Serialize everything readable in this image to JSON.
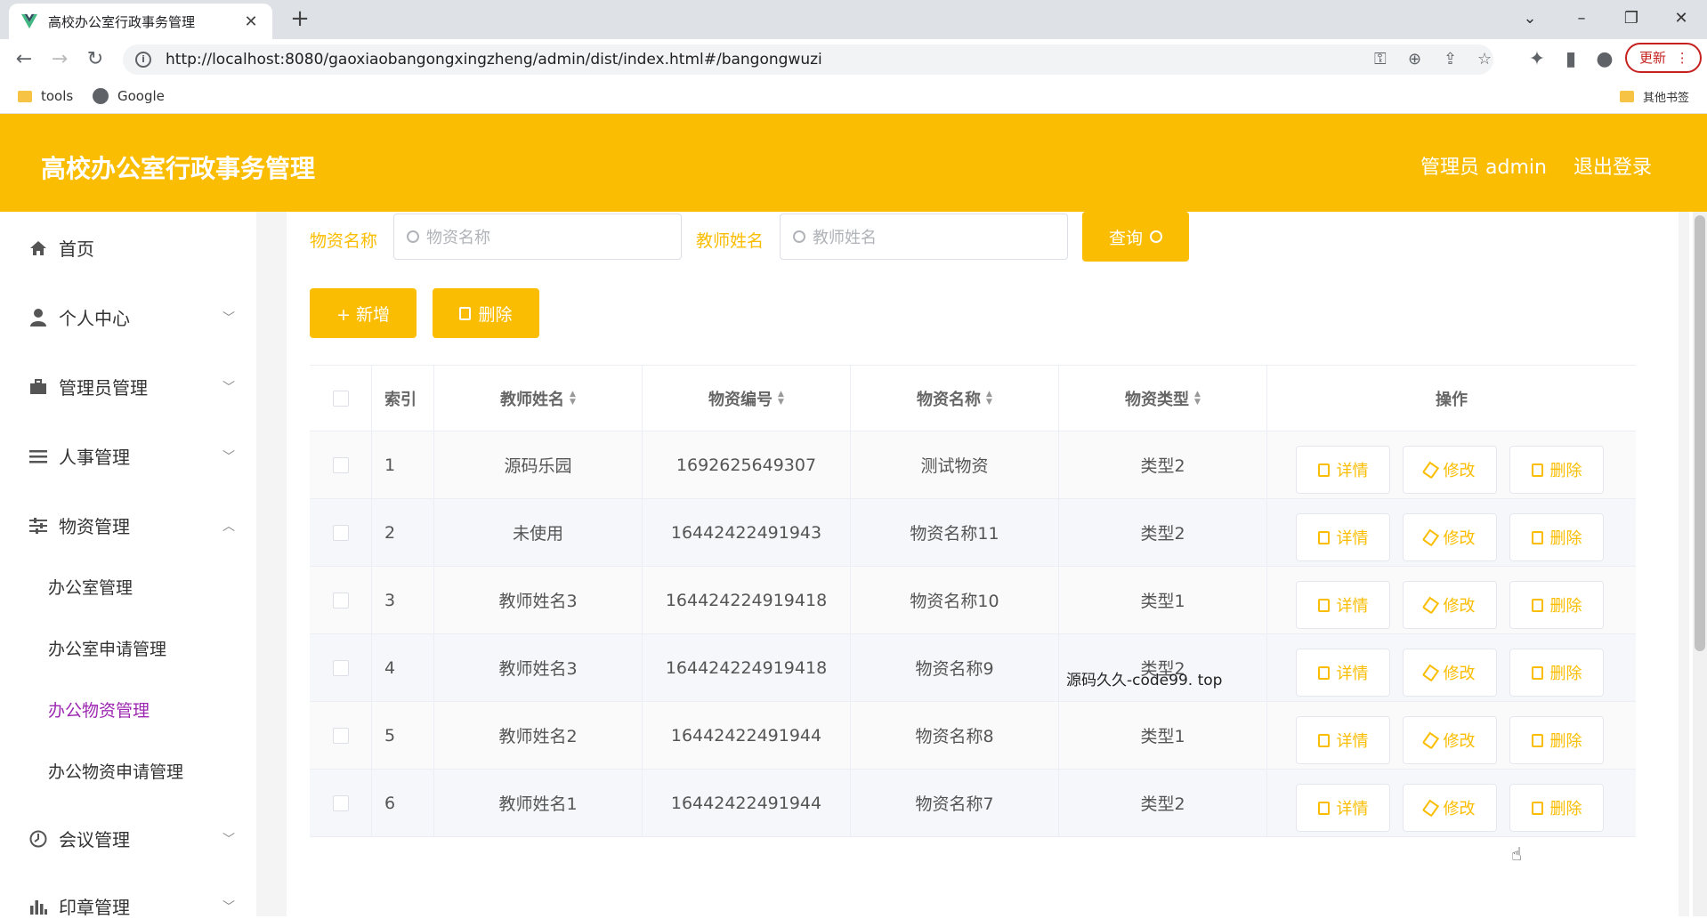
{
  "browser": {
    "tab_title": "高校办公室行政事务管理",
    "url": "http://localhost:8080/gaoxiaobangongxingzheng/admin/dist/index.html#/bangongwuzi",
    "update_label": "更新",
    "bookmarks": [
      "tools",
      "Google"
    ],
    "other_bookmarks": "其他书签"
  },
  "header": {
    "title": "高校办公室行政事务管理",
    "user": "管理员 admin",
    "logout": "退出登录"
  },
  "sidebar": {
    "items": [
      {
        "label": "首页"
      },
      {
        "label": "个人中心"
      },
      {
        "label": "管理员管理"
      },
      {
        "label": "人事管理"
      },
      {
        "label": "物资管理"
      },
      {
        "label": "会议管理"
      },
      {
        "label": "印章管理"
      }
    ],
    "sub_items": [
      {
        "label": "办公室管理"
      },
      {
        "label": "办公室申请管理"
      },
      {
        "label": "办公物资管理"
      },
      {
        "label": "办公物资申请管理"
      }
    ]
  },
  "search": {
    "name_label": "物资名称",
    "name_placeholder": "物资名称",
    "teacher_label": "教师姓名",
    "teacher_placeholder": "教师姓名",
    "query_label": "查询"
  },
  "actions": {
    "add_label": "+ 新增",
    "delete_label": "删除"
  },
  "table": {
    "columns": [
      "索引",
      "教师姓名",
      "物资编号",
      "物资名称",
      "物资类型",
      "操作"
    ],
    "ops": {
      "detail": "详情",
      "edit": "修改",
      "delete": "删除"
    },
    "rows": [
      {
        "index": "1",
        "teacher": "源码乐园",
        "code": "1692625649307",
        "name": "测试物资",
        "type": "类型2"
      },
      {
        "index": "2",
        "teacher": "未使用",
        "code": "16442422491943",
        "name": "物资名称11",
        "type": "类型2"
      },
      {
        "index": "3",
        "teacher": "教师姓名3",
        "code": "164424224919418",
        "name": "物资名称10",
        "type": "类型1"
      },
      {
        "index": "4",
        "teacher": "教师姓名3",
        "code": "164424224919418",
        "name": "物资名称9",
        "type": "类型2"
      },
      {
        "index": "5",
        "teacher": "教师姓名2",
        "code": "16442422491944",
        "name": "物资名称8",
        "type": "类型1"
      },
      {
        "index": "6",
        "teacher": "教师姓名1",
        "code": "16442422491944",
        "name": "物资名称7",
        "type": "类型2"
      }
    ]
  },
  "overlay_text": "源码久久-code99. top"
}
